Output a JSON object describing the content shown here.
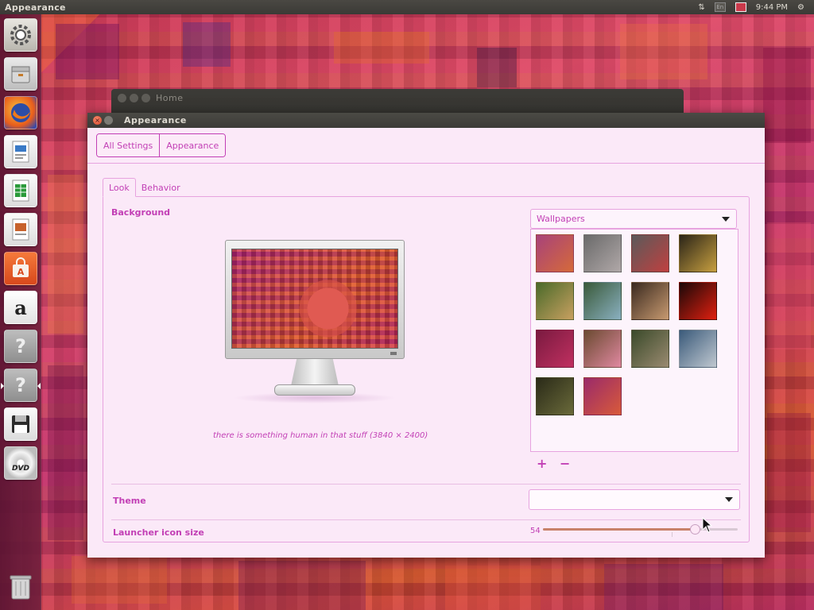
{
  "top_panel": {
    "app_title": "Appearance",
    "keyboard_indicator": "En",
    "clock": "9:44 PM"
  },
  "launcher": {
    "items": [
      {
        "name": "system-settings",
        "icon": "gear-icon",
        "color": "#d6d3cc"
      },
      {
        "name": "files",
        "icon": "file-cabinet-icon",
        "color": "#cfcfcf"
      },
      {
        "name": "firefox",
        "icon": "firefox-icon",
        "color": "#f28a1d"
      },
      {
        "name": "libreoffice-writer",
        "icon": "writer-document-icon",
        "color": "#3a7ac6"
      },
      {
        "name": "libreoffice-calc",
        "icon": "calc-spreadsheet-icon",
        "color": "#2a9a3a"
      },
      {
        "name": "libreoffice-impress",
        "icon": "impress-presentation-icon",
        "color": "#c7622c"
      },
      {
        "name": "ubuntu-software",
        "icon": "shopping-bag-icon",
        "color": "#e95a2b"
      },
      {
        "name": "amazon",
        "icon": "amazon-icon",
        "color": "#f4f4f4"
      },
      {
        "name": "unknown-app",
        "icon": "question-mark-icon",
        "color": "#9a9a9a"
      },
      {
        "name": "unknown-app-active",
        "icon": "question-mark-icon",
        "color": "#9a9a9a"
      },
      {
        "name": "floppy-drive",
        "icon": "floppy-disk-icon",
        "color": "#3a3a3a"
      },
      {
        "name": "dvd-drive",
        "icon": "dvd-icon",
        "color": "#d8d8d8"
      },
      {
        "name": "trash",
        "icon": "trash-icon",
        "color": "#bdbdbd"
      }
    ],
    "item_labels": {
      "amazon": "a",
      "unknown": "?",
      "dvd": "DVD"
    }
  },
  "home_window": {
    "title": "Home"
  },
  "window": {
    "title": "Appearance",
    "breadcrumbs": [
      "All Settings",
      "Appearance"
    ],
    "tabs": [
      "Look",
      "Behavior"
    ],
    "active_tab": "Look",
    "background": {
      "label": "Background",
      "source_selected": "Wallpapers",
      "caption": "there is something human in that stuff (3840 × 2400)",
      "thumbnails": [
        {
          "name": "gradient-purple-orange",
          "colors": [
            "#a8427a",
            "#d56a3a"
          ]
        },
        {
          "name": "pebbles-with-clock",
          "colors": [
            "#6a6a6a",
            "#b0a8a8"
          ]
        },
        {
          "name": "pebbles-red-leaf",
          "colors": [
            "#5a5a5a",
            "#c04040"
          ]
        },
        {
          "name": "colorful-beans",
          "colors": [
            "#2a2418",
            "#c8a040"
          ]
        },
        {
          "name": "green-leaf",
          "colors": [
            "#4a6a2a",
            "#c8a060"
          ]
        },
        {
          "name": "mountain-river",
          "colors": [
            "#3a5a3a",
            "#8ab0c0"
          ]
        },
        {
          "name": "mushrooms",
          "colors": [
            "#3a2a20",
            "#c89a70"
          ]
        },
        {
          "name": "red-light-trail",
          "colors": [
            "#1a0808",
            "#e02010"
          ]
        },
        {
          "name": "dark-pink-abstract",
          "colors": [
            "#7a1a40",
            "#c03060"
          ]
        },
        {
          "name": "pink-flower",
          "colors": [
            "#6a4a30",
            "#e088a0"
          ]
        },
        {
          "name": "railway-tunnel",
          "colors": [
            "#3a4a2a",
            "#9a8a70"
          ]
        },
        {
          "name": "seaside-pier",
          "colors": [
            "#3a5a7a",
            "#c0c8d0"
          ]
        },
        {
          "name": "old-books",
          "colors": [
            "#2a2a18",
            "#6a6a3a"
          ]
        },
        {
          "name": "current-abstract-wallpaper",
          "colors": [
            "#9a2a6a",
            "#d85a3a"
          ]
        }
      ],
      "add_label": "+",
      "remove_label": "−"
    },
    "theme": {
      "label": "Theme",
      "value": ""
    },
    "launcher_icon_size": {
      "label": "Launcher icon size",
      "value": "54",
      "level_fraction": 0.78
    }
  },
  "colors": {
    "accent": "#c23fb5",
    "window_bg": "#fbe9f8",
    "border": "#e7a3df"
  }
}
